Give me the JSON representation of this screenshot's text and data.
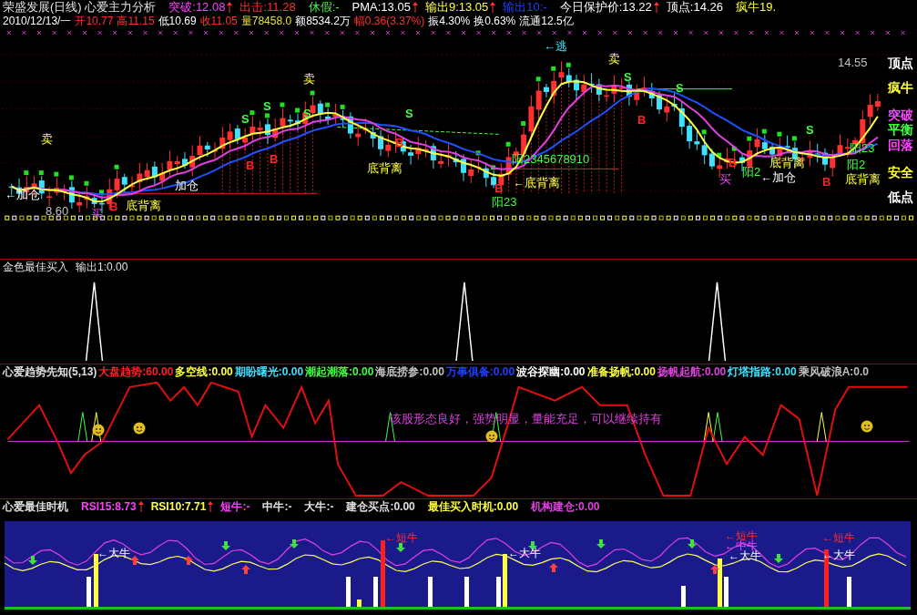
{
  "header": {
    "row1": [
      {
        "text": "荣盛发展(日线) 心爱主力分析",
        "color": "#e0e0e0",
        "arrow": false
      },
      {
        "text": "突破:12.08",
        "color": "#ff40ff",
        "arrow": true
      },
      {
        "text": "出击:11.28",
        "color": "#ff3030",
        "arrow": false
      },
      {
        "text": "休假:-",
        "color": "#40ff40",
        "arrow": false
      },
      {
        "text": "PMA:13.05",
        "color": "#ffffff",
        "arrow": true
      },
      {
        "text": "输出9:13.05",
        "color": "#ffff40",
        "arrow": true
      },
      {
        "text": "输出10:-",
        "color": "#2040ff",
        "arrow": false
      },
      {
        "text": "今日保护价:13.22",
        "color": "#ffffff",
        "arrow": true
      },
      {
        "text": "顶点:14.26",
        "color": "#ffffff",
        "arrow": false
      },
      {
        "text": "疯牛19.",
        "color": "#ffff40",
        "arrow": false
      }
    ],
    "row2": [
      {
        "text": "2010/12/13/一",
        "color": "#ffffff"
      },
      {
        "text": "开10.77",
        "color": "#ff3030"
      },
      {
        "text": "高11.15",
        "color": "#ff3030"
      },
      {
        "text": "低10.69",
        "color": "#ffffff"
      },
      {
        "text": "收11.05",
        "color": "#ff3030"
      },
      {
        "text": "量78458.0",
        "color": "#e0e040"
      },
      {
        "text": "额8534.2万",
        "color": "#ffffff"
      },
      {
        "text": "幅0.36(3.37%)",
        "color": "#ff3030"
      },
      {
        "text": "振4.30%",
        "color": "#ffffff"
      },
      {
        "text": "换0.63%",
        "color": "#ffffff"
      },
      {
        "text": "流通12.5亿",
        "color": "#ffffff"
      }
    ]
  },
  "main_chart": {
    "annotations": [
      {
        "text": "←逃",
        "kind": "escape"
      },
      {
        "text": "卖",
        "kind": "sell"
      },
      {
        "text": "卖",
        "kind": "sell"
      },
      {
        "text": "卖",
        "kind": "sell"
      },
      {
        "text": "←加仓",
        "kind": "add"
      },
      {
        "text": "加仓",
        "kind": "add"
      },
      {
        "text": "底背离",
        "kind": "divergence"
      },
      {
        "text": "底背离",
        "kind": "divergence"
      },
      {
        "text": "←底背离",
        "kind": "divergence"
      },
      {
        "text": "←加仓",
        "kind": "add"
      },
      {
        "text": "底背离",
        "kind": "divergence"
      },
      {
        "text": "阳2",
        "kind": "stage"
      },
      {
        "text": "底背离",
        "kind": "divergence"
      },
      {
        "text": "阳23",
        "kind": "stage"
      },
      {
        "text": "阳2345678910",
        "kind": "stage"
      },
      {
        "text": "阳2",
        "kind": "stage"
      },
      {
        "text": "阳23",
        "kind": "stage"
      },
      {
        "text": "8.60",
        "kind": "price"
      },
      {
        "text": "买",
        "kind": "buy"
      },
      {
        "text": "买",
        "kind": "buy"
      },
      {
        "text": "14.55",
        "kind": "price"
      },
      {
        "text": "B",
        "kind": "b"
      },
      {
        "text": "B",
        "kind": "b"
      },
      {
        "text": "B",
        "kind": "b"
      },
      {
        "text": "B",
        "kind": "b"
      },
      {
        "text": "B",
        "kind": "b"
      },
      {
        "text": "B",
        "kind": "b"
      },
      {
        "text": "B",
        "kind": "b"
      },
      {
        "text": "B",
        "kind": "b"
      },
      {
        "text": "S",
        "kind": "s"
      },
      {
        "text": "S",
        "kind": "s"
      },
      {
        "text": "S",
        "kind": "s"
      },
      {
        "text": "S",
        "kind": "s"
      },
      {
        "text": "S",
        "kind": "s"
      },
      {
        "text": "S",
        "kind": "s"
      },
      {
        "text": "S",
        "kind": "s"
      }
    ],
    "level_labels": [
      {
        "text": "顶点",
        "color": "#ffffff"
      },
      {
        "text": "疯牛",
        "color": "#ffff40"
      },
      {
        "text": "突破",
        "color": "#ff40ff"
      },
      {
        "text": "平衡",
        "color": "#40ff40"
      },
      {
        "text": "回落",
        "color": "#ff40ff"
      },
      {
        "text": "安全",
        "color": "#ffff40"
      },
      {
        "text": "低点",
        "color": "#ffffff"
      }
    ]
  },
  "panel_2": {
    "header": [
      {
        "text": "金色最佳买入",
        "color": "#e0e0e0"
      },
      {
        "text": "输出1:0.00",
        "color": "#e0e0e0"
      }
    ]
  },
  "panel_3": {
    "header": [
      {
        "text": "心爱趋势先知(5,13)",
        "color": "#e0e0e0"
      },
      {
        "text": "大盘趋势:60.00",
        "color": "#ff2020"
      },
      {
        "text": "多空线:0.00",
        "color": "#ffff40"
      },
      {
        "text": "期盼曙光:0.00",
        "color": "#40e0ff"
      },
      {
        "text": "潮起潮落:0.00",
        "color": "#40ff40"
      },
      {
        "text": "海底捞参:0.00",
        "color": "#c0c0c0"
      },
      {
        "text": "万事俱备:0.00",
        "color": "#2040ff"
      },
      {
        "text": "波谷探幽:0.00",
        "color": "#ffffff"
      },
      {
        "text": "准备扬帆:0.00",
        "color": "#ffff40"
      },
      {
        "text": "扬帆起航:0.00",
        "color": "#e040e0"
      },
      {
        "text": "灯塔指路:0.00",
        "color": "#40e0ff"
      },
      {
        "text": "乘风破浪A:0.0",
        "color": "#c0c0c0"
      }
    ],
    "message": "该股形态良好，强势明显，量能充足，可以继续持有"
  },
  "panel_4": {
    "header": [
      {
        "text": "心爱最佳时机",
        "color": "#e0e0e0",
        "arrow": false
      },
      {
        "text": "RSI15:8.73",
        "color": "#ff40ff",
        "arrow": true
      },
      {
        "text": "RSI10:7.71",
        "color": "#ffff40",
        "arrow": true
      },
      {
        "text": "短牛:-",
        "color": "#ff40ff",
        "arrow": false
      },
      {
        "text": "中牛:-",
        "color": "#e0e0e0",
        "arrow": false
      },
      {
        "text": "大牛:-",
        "color": "#e0e0e0",
        "arrow": false
      },
      {
        "text": "建仓买点:0.00",
        "color": "#e0e0e0",
        "arrow": false
      },
      {
        "text": "最佳买入时机:0.00",
        "color": "#ffff40",
        "arrow": false
      },
      {
        "text": "机构建仓:0.00",
        "color": "#e040e0",
        "arrow": false
      }
    ],
    "annotations": [
      {
        "text": "←大牛",
        "kind": "big"
      },
      {
        "text": "←短牛",
        "kind": "short"
      },
      {
        "text": "←大牛",
        "kind": "big"
      },
      {
        "text": "←短牛",
        "kind": "short"
      },
      {
        "text": "←中牛",
        "kind": "mid"
      },
      {
        "text": "←大牛",
        "kind": "big"
      },
      {
        "text": "←短牛",
        "kind": "short"
      },
      {
        "text": "←大牛",
        "kind": "big"
      }
    ]
  }
}
